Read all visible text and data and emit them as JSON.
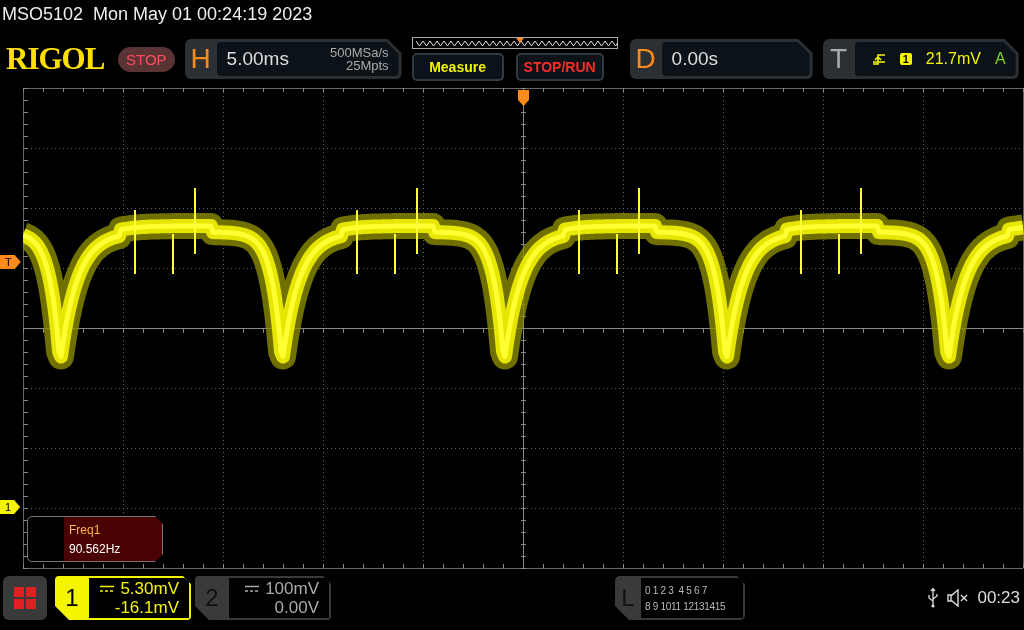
{
  "header": {
    "model": "MSO5102",
    "datetime": "Mon May 01 00:24:19 2023"
  },
  "toolbar": {
    "logo": "RIGOL",
    "run_state": {
      "label": "STOP",
      "kind": "stop"
    },
    "horizontal": {
      "letter": "H",
      "timebase": "5.00ms",
      "sample_rate": "500MSa/s",
      "memory_depth": "25Mpts"
    },
    "buttons": [
      {
        "label": "Measure",
        "kind": "measure"
      },
      {
        "label": "STOP/RUN",
        "kind": "stoprun"
      }
    ],
    "delay": {
      "letter": "D",
      "value": "0.00s"
    },
    "trigger": {
      "letter": "T",
      "channel": "1",
      "level": "21.7mV",
      "mode": "A"
    }
  },
  "display": {
    "trigger_marker": "T",
    "channel_marker": "1",
    "measurement": {
      "name": "Freq1",
      "value": "90.562Hz"
    }
  },
  "channels": [
    {
      "number": "1",
      "scale": "5.30mV",
      "offset": "-16.1mV",
      "selected": true
    },
    {
      "number": "2",
      "scale": "100mV",
      "offset": "0.00V",
      "selected": false
    }
  ],
  "logic": {
    "letter": "L",
    "rows": [
      "0 1 2 3  4 5 6 7",
      "8 9 1011 12131415"
    ]
  },
  "status": {
    "time": "00:23"
  }
}
